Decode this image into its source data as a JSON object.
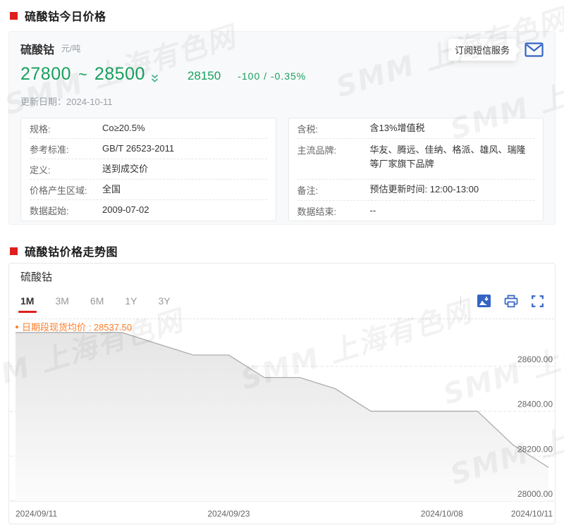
{
  "watermark_text": "SMM 上海有色网",
  "colors": {
    "accent_red": "#e01e1e",
    "price_green": "#18a05f",
    "legend_orange": "#ff7d26",
    "icon_blue": "#3464c4"
  },
  "section_today": {
    "title": "硫酸钴今日价格",
    "product_name": "硫酸钴",
    "unit": "元/吨",
    "price_low": "27800",
    "tilde": "~",
    "price_high": "28500",
    "avg_price": "28150",
    "change": "-100 / -0.35%",
    "update_date": "更新日期：2024-10-11",
    "subscribe_button": "订阅短信服务",
    "spec_table_left": [
      {
        "label": "规格:",
        "value": "Co≥20.5%"
      },
      {
        "label": "参考标准:",
        "value": "GB/T 26523-2011"
      },
      {
        "label": "定义:",
        "value": "送到成交价"
      },
      {
        "label": "价格产生区域:",
        "value": "全国"
      },
      {
        "label": "数据起始:",
        "value": "2009-07-02"
      }
    ],
    "spec_table_right": [
      {
        "label": "含税:",
        "value": "含13%增值税"
      },
      {
        "label": "主流品牌:",
        "value": "华友、腾远、佳纳、格派、雄风、瑞隆等厂家旗下品牌"
      },
      {
        "label": "备注:",
        "value": "预估更新时间: 12:00-13:00"
      },
      {
        "label": "数据结束:",
        "value": "--"
      }
    ]
  },
  "section_trend": {
    "title": "硫酸钴价格走势图",
    "chart_title": "硫酸钴",
    "tabs": [
      "1M",
      "3M",
      "6M",
      "1Y",
      "3Y"
    ],
    "active_tab": "1M",
    "legend": "日期段现货均价 : 28537.50"
  },
  "chart_data": {
    "type": "area",
    "title": "硫酸钴",
    "series_name": "日期段现货均价",
    "average": 28537.5,
    "x": [
      "2024/09/11",
      "2024/09/12",
      "2024/09/13",
      "2024/09/18",
      "2024/09/19",
      "2024/09/20",
      "2024/09/23",
      "2024/09/24",
      "2024/09/25",
      "2024/09/26",
      "2024/09/27",
      "2024/09/30",
      "2024/10/08",
      "2024/10/09",
      "2024/10/10",
      "2024/10/11"
    ],
    "values": [
      28750,
      28750,
      28750,
      28750,
      28700,
      28650,
      28650,
      28550,
      28550,
      28500,
      28400,
      28400,
      28400,
      28400,
      28250,
      28150
    ],
    "ylim": [
      28000,
      28800
    ],
    "y_ticks": [
      {
        "v": 28000,
        "label": "28000.00"
      },
      {
        "v": 28200,
        "label": "28200.00"
      },
      {
        "v": 28400,
        "label": "28400.00"
      },
      {
        "v": 28600,
        "label": "28600.00"
      }
    ],
    "x_label_indices": [
      0,
      6,
      12,
      15
    ],
    "grid": "dashed horizontal, labels right",
    "legend_position": "top-left",
    "line_color": "#a6a6a6",
    "area_top_color": "#e5e5e5",
    "area_bottom_color": "#fcfcfc"
  }
}
